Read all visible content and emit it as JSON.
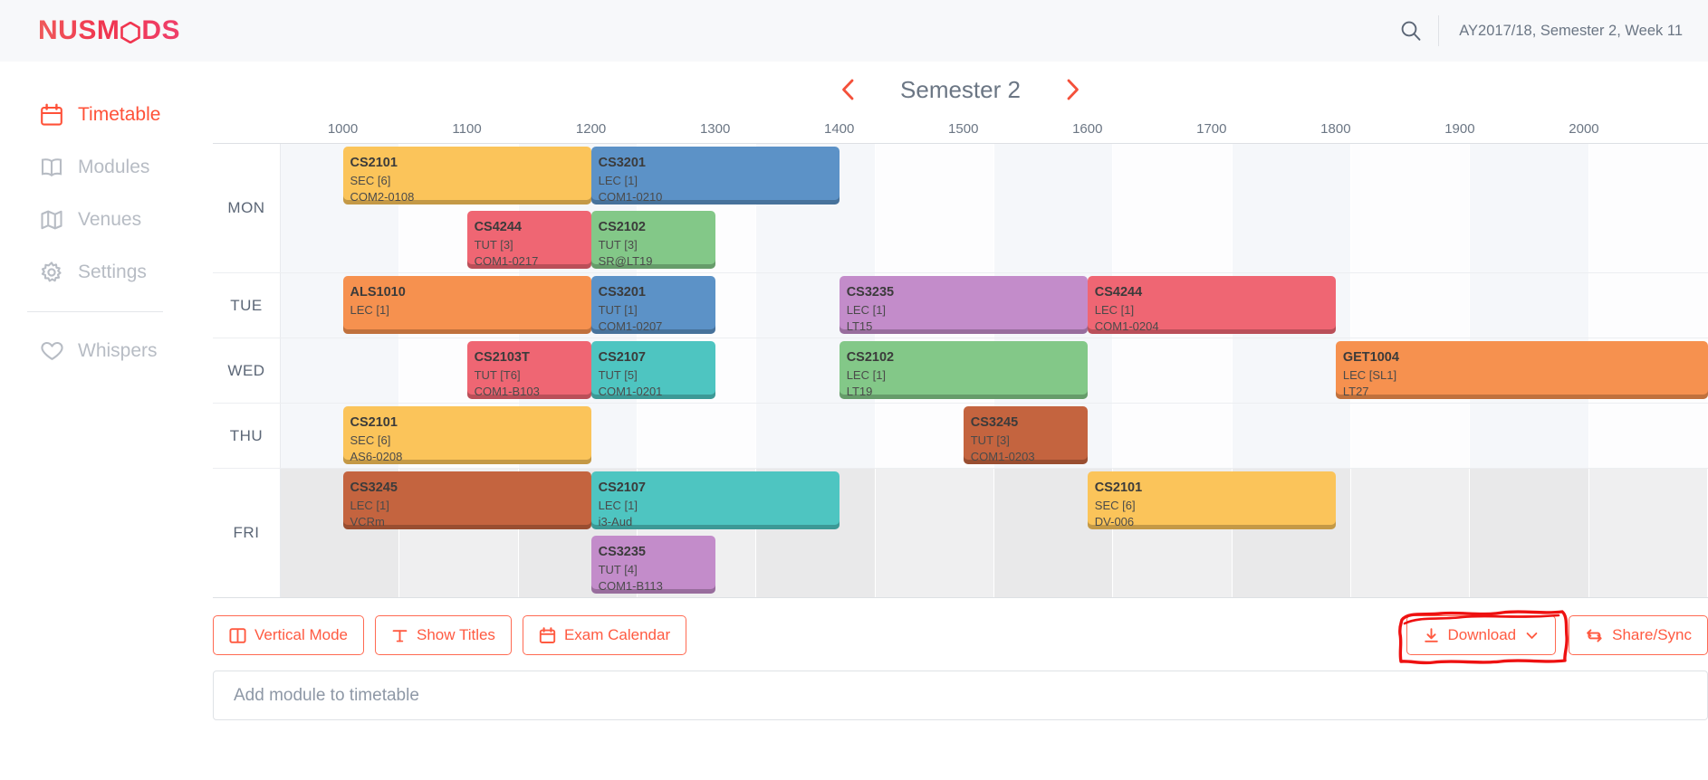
{
  "brand": {
    "text_before": "NUSM",
    "text_after": "DS",
    "full": "NUSMODS",
    "accent": "#f0354f"
  },
  "navbar": {
    "search_icon": "search-icon",
    "academic_label": "AY2017/18, Semester 2, Week 11"
  },
  "sidebar": {
    "items": [
      {
        "label": "Timetable",
        "icon": "calendar-icon",
        "active": true
      },
      {
        "label": "Modules",
        "icon": "book-icon",
        "active": false
      },
      {
        "label": "Venues",
        "icon": "map-icon",
        "active": false
      },
      {
        "label": "Settings",
        "icon": "gear-icon",
        "active": false
      },
      {
        "label": "Whispers",
        "icon": "heart-icon",
        "active": false
      }
    ]
  },
  "semester_nav": {
    "prev_icon": "chevron-left-icon",
    "next_icon": "chevron-right-icon",
    "title": "Semester 2"
  },
  "timetable": {
    "time_labels": [
      "1000",
      "1100",
      "1200",
      "1300",
      "1400",
      "1500",
      "1600",
      "1700",
      "1800",
      "1900",
      "2000"
    ],
    "start_hour": 9.5,
    "end_hour": 21.0,
    "days": [
      {
        "day": "MON",
        "lanes": 2
      },
      {
        "day": "TUE",
        "lanes": 1
      },
      {
        "day": "WED",
        "lanes": 1
      },
      {
        "day": "THU",
        "lanes": 1
      },
      {
        "day": "FRI",
        "lanes": 2
      }
    ],
    "lessons": [
      {
        "day": "MON",
        "lane": 0,
        "code": "CS2101",
        "type": "SEC [6]",
        "venue": "COM2-0108",
        "start": 10.0,
        "end": 12.0,
        "color": "#fbc45a"
      },
      {
        "day": "MON",
        "lane": 0,
        "code": "CS3201",
        "type": "LEC [1]",
        "venue": "COM1-0210",
        "start": 12.0,
        "end": 14.0,
        "color": "#5c92c7"
      },
      {
        "day": "MON",
        "lane": 1,
        "code": "CS4244",
        "type": "TUT [3]",
        "venue": "COM1-0217",
        "start": 11.0,
        "end": 12.0,
        "color": "#ef6673"
      },
      {
        "day": "MON",
        "lane": 1,
        "code": "CS2102",
        "type": "TUT [3]",
        "venue": "SR@LT19",
        "start": 12.0,
        "end": 13.0,
        "color": "#83c888"
      },
      {
        "day": "TUE",
        "lane": 0,
        "code": "ALS1010",
        "type": "LEC [1]",
        "venue": "",
        "start": 10.0,
        "end": 12.0,
        "color": "#f6914f"
      },
      {
        "day": "TUE",
        "lane": 0,
        "code": "CS3201",
        "type": "TUT [1]",
        "venue": "COM1-0207",
        "start": 12.0,
        "end": 13.0,
        "color": "#5c92c7"
      },
      {
        "day": "TUE",
        "lane": 0,
        "code": "CS3235",
        "type": "LEC [1]",
        "venue": "LT15",
        "start": 14.0,
        "end": 16.0,
        "color": "#c38cca"
      },
      {
        "day": "TUE",
        "lane": 0,
        "code": "CS4244",
        "type": "LEC [1]",
        "venue": "COM1-0204",
        "start": 16.0,
        "end": 18.0,
        "color": "#ef6673"
      },
      {
        "day": "WED",
        "lane": 0,
        "code": "CS2103T",
        "type": "TUT [T6]",
        "venue": "COM1-B103",
        "start": 11.0,
        "end": 12.0,
        "color": "#ef6673"
      },
      {
        "day": "WED",
        "lane": 0,
        "code": "CS2107",
        "type": "TUT [5]",
        "venue": "COM1-0201",
        "start": 12.0,
        "end": 13.0,
        "color": "#4ec5c1"
      },
      {
        "day": "WED",
        "lane": 0,
        "code": "CS2102",
        "type": "LEC [1]",
        "venue": "LT19",
        "start": 14.0,
        "end": 16.0,
        "color": "#83c888"
      },
      {
        "day": "WED",
        "lane": 0,
        "code": "GET1004",
        "type": "LEC [SL1]",
        "venue": "LT27",
        "start": 18.0,
        "end": 21.0,
        "color": "#f6914f"
      },
      {
        "day": "THU",
        "lane": 0,
        "code": "CS2101",
        "type": "SEC [6]",
        "venue": "AS6-0208",
        "start": 10.0,
        "end": 12.0,
        "color": "#fbc45a"
      },
      {
        "day": "THU",
        "lane": 0,
        "code": "CS3245",
        "type": "TUT [3]",
        "venue": "COM1-0203",
        "start": 15.0,
        "end": 16.0,
        "color": "#c4643f"
      },
      {
        "day": "FRI",
        "lane": 0,
        "code": "CS3245",
        "type": "LEC [1]",
        "venue": "VCRm",
        "start": 10.0,
        "end": 12.0,
        "color": "#c4643f"
      },
      {
        "day": "FRI",
        "lane": 0,
        "code": "CS2107",
        "type": "LEC [1]",
        "venue": "i3-Aud",
        "start": 12.0,
        "end": 14.0,
        "color": "#4ec5c1"
      },
      {
        "day": "FRI",
        "lane": 0,
        "code": "CS2101",
        "type": "SEC [6]",
        "venue": "DV-006",
        "start": 16.0,
        "end": 18.0,
        "color": "#fbc45a"
      },
      {
        "day": "FRI",
        "lane": 1,
        "code": "CS3235",
        "type": "TUT [4]",
        "venue": "COM1-B113",
        "start": 12.0,
        "end": 13.0,
        "color": "#c38cca"
      }
    ]
  },
  "toolbar": {
    "left_buttons": [
      {
        "label": "Vertical Mode",
        "icon": "columns-icon"
      },
      {
        "label": "Show Titles",
        "icon": "type-icon"
      },
      {
        "label": "Exam Calendar",
        "icon": "calendar-icon"
      }
    ],
    "download": {
      "label": "Download",
      "icon": "download-icon",
      "chevron": "chevron-down-icon"
    },
    "share": {
      "label": "Share/Sync",
      "icon": "share-sync-icon",
      "highlighted": true
    },
    "accent": "#ff5a41"
  },
  "add_module": {
    "placeholder": "Add module to timetable",
    "value": ""
  }
}
